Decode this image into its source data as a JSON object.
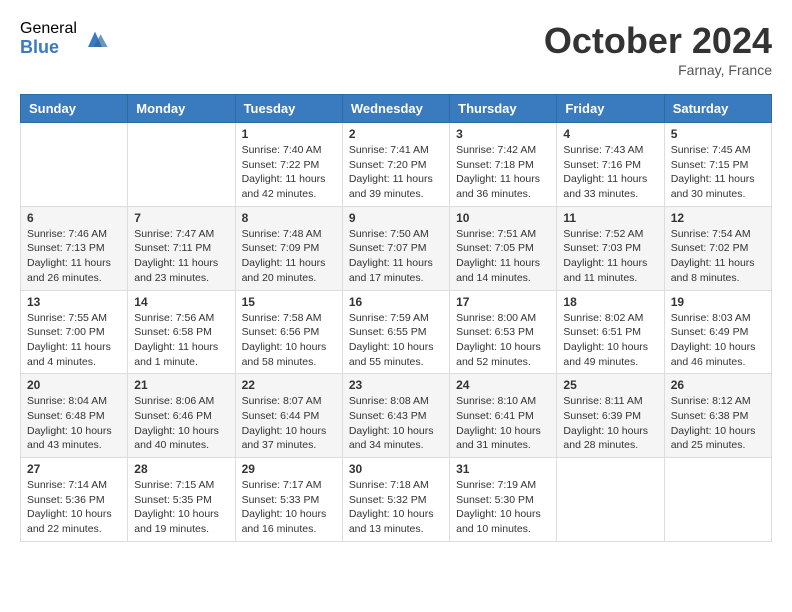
{
  "header": {
    "logo_general": "General",
    "logo_blue": "Blue",
    "month_title": "October 2024",
    "location": "Farnay, France"
  },
  "days_of_week": [
    "Sunday",
    "Monday",
    "Tuesday",
    "Wednesday",
    "Thursday",
    "Friday",
    "Saturday"
  ],
  "weeks": [
    [
      {
        "day": "",
        "info": ""
      },
      {
        "day": "",
        "info": ""
      },
      {
        "day": "1",
        "info": "Sunrise: 7:40 AM\nSunset: 7:22 PM\nDaylight: 11 hours and 42 minutes."
      },
      {
        "day": "2",
        "info": "Sunrise: 7:41 AM\nSunset: 7:20 PM\nDaylight: 11 hours and 39 minutes."
      },
      {
        "day": "3",
        "info": "Sunrise: 7:42 AM\nSunset: 7:18 PM\nDaylight: 11 hours and 36 minutes."
      },
      {
        "day": "4",
        "info": "Sunrise: 7:43 AM\nSunset: 7:16 PM\nDaylight: 11 hours and 33 minutes."
      },
      {
        "day": "5",
        "info": "Sunrise: 7:45 AM\nSunset: 7:15 PM\nDaylight: 11 hours and 30 minutes."
      }
    ],
    [
      {
        "day": "6",
        "info": "Sunrise: 7:46 AM\nSunset: 7:13 PM\nDaylight: 11 hours and 26 minutes."
      },
      {
        "day": "7",
        "info": "Sunrise: 7:47 AM\nSunset: 7:11 PM\nDaylight: 11 hours and 23 minutes."
      },
      {
        "day": "8",
        "info": "Sunrise: 7:48 AM\nSunset: 7:09 PM\nDaylight: 11 hours and 20 minutes."
      },
      {
        "day": "9",
        "info": "Sunrise: 7:50 AM\nSunset: 7:07 PM\nDaylight: 11 hours and 17 minutes."
      },
      {
        "day": "10",
        "info": "Sunrise: 7:51 AM\nSunset: 7:05 PM\nDaylight: 11 hours and 14 minutes."
      },
      {
        "day": "11",
        "info": "Sunrise: 7:52 AM\nSunset: 7:03 PM\nDaylight: 11 hours and 11 minutes."
      },
      {
        "day": "12",
        "info": "Sunrise: 7:54 AM\nSunset: 7:02 PM\nDaylight: 11 hours and 8 minutes."
      }
    ],
    [
      {
        "day": "13",
        "info": "Sunrise: 7:55 AM\nSunset: 7:00 PM\nDaylight: 11 hours and 4 minutes."
      },
      {
        "day": "14",
        "info": "Sunrise: 7:56 AM\nSunset: 6:58 PM\nDaylight: 11 hours and 1 minute."
      },
      {
        "day": "15",
        "info": "Sunrise: 7:58 AM\nSunset: 6:56 PM\nDaylight: 10 hours and 58 minutes."
      },
      {
        "day": "16",
        "info": "Sunrise: 7:59 AM\nSunset: 6:55 PM\nDaylight: 10 hours and 55 minutes."
      },
      {
        "day": "17",
        "info": "Sunrise: 8:00 AM\nSunset: 6:53 PM\nDaylight: 10 hours and 52 minutes."
      },
      {
        "day": "18",
        "info": "Sunrise: 8:02 AM\nSunset: 6:51 PM\nDaylight: 10 hours and 49 minutes."
      },
      {
        "day": "19",
        "info": "Sunrise: 8:03 AM\nSunset: 6:49 PM\nDaylight: 10 hours and 46 minutes."
      }
    ],
    [
      {
        "day": "20",
        "info": "Sunrise: 8:04 AM\nSunset: 6:48 PM\nDaylight: 10 hours and 43 minutes."
      },
      {
        "day": "21",
        "info": "Sunrise: 8:06 AM\nSunset: 6:46 PM\nDaylight: 10 hours and 40 minutes."
      },
      {
        "day": "22",
        "info": "Sunrise: 8:07 AM\nSunset: 6:44 PM\nDaylight: 10 hours and 37 minutes."
      },
      {
        "day": "23",
        "info": "Sunrise: 8:08 AM\nSunset: 6:43 PM\nDaylight: 10 hours and 34 minutes."
      },
      {
        "day": "24",
        "info": "Sunrise: 8:10 AM\nSunset: 6:41 PM\nDaylight: 10 hours and 31 minutes."
      },
      {
        "day": "25",
        "info": "Sunrise: 8:11 AM\nSunset: 6:39 PM\nDaylight: 10 hours and 28 minutes."
      },
      {
        "day": "26",
        "info": "Sunrise: 8:12 AM\nSunset: 6:38 PM\nDaylight: 10 hours and 25 minutes."
      }
    ],
    [
      {
        "day": "27",
        "info": "Sunrise: 7:14 AM\nSunset: 5:36 PM\nDaylight: 10 hours and 22 minutes."
      },
      {
        "day": "28",
        "info": "Sunrise: 7:15 AM\nSunset: 5:35 PM\nDaylight: 10 hours and 19 minutes."
      },
      {
        "day": "29",
        "info": "Sunrise: 7:17 AM\nSunset: 5:33 PM\nDaylight: 10 hours and 16 minutes."
      },
      {
        "day": "30",
        "info": "Sunrise: 7:18 AM\nSunset: 5:32 PM\nDaylight: 10 hours and 13 minutes."
      },
      {
        "day": "31",
        "info": "Sunrise: 7:19 AM\nSunset: 5:30 PM\nDaylight: 10 hours and 10 minutes."
      },
      {
        "day": "",
        "info": ""
      },
      {
        "day": "",
        "info": ""
      }
    ]
  ]
}
